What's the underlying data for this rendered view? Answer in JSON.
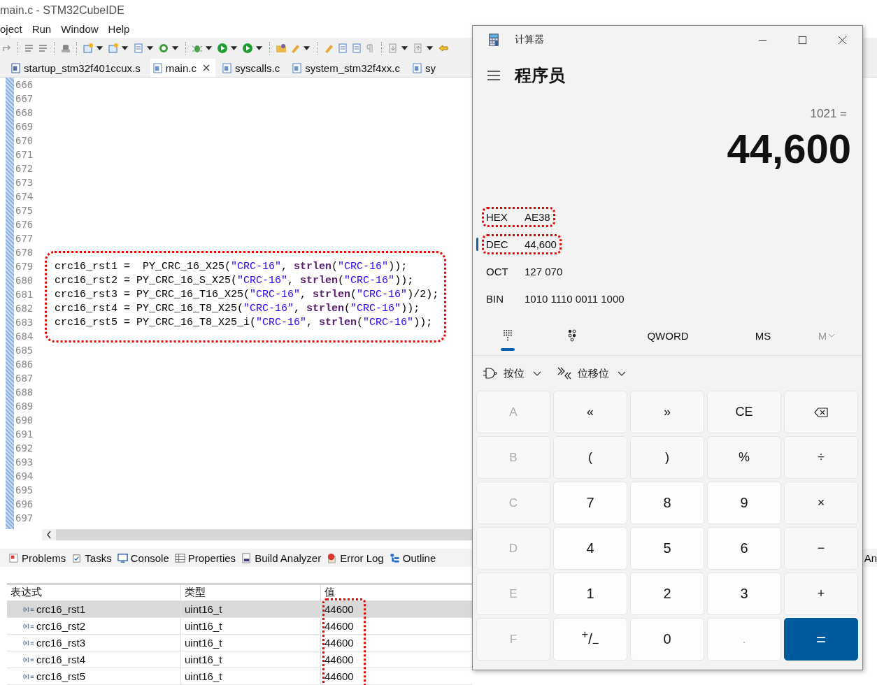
{
  "ide": {
    "title": "main.c - STM32CubeIDE",
    "menu": [
      "oject",
      "Run",
      "Window",
      "Help"
    ],
    "editor_tabs": [
      {
        "label": "startup_stm32f401ccux.s",
        "kind": "asm",
        "selected": false
      },
      {
        "label": "main.c",
        "kind": "c",
        "selected": true
      },
      {
        "label": "syscalls.c",
        "kind": "c",
        "selected": false
      },
      {
        "label": "system_stm32f4xx.c",
        "kind": "c",
        "selected": false
      },
      {
        "label": "sy",
        "kind": "c",
        "selected": false
      }
    ],
    "editor": {
      "outlined": true,
      "lines": [
        {
          "number": "666"
        },
        {
          "number": "667"
        },
        {
          "number": "668"
        },
        {
          "number": "669"
        },
        {
          "number": "670"
        },
        {
          "number": "671"
        },
        {
          "number": "672"
        },
        {
          "number": "673"
        },
        {
          "number": "674"
        },
        {
          "number": "675"
        },
        {
          "number": "676"
        },
        {
          "number": "677"
        },
        {
          "number": "678"
        },
        {
          "number": "679",
          "code": [
            {
              "kind": "plain",
              "text": "crc16_rst1 =  PY_CRC_16_X25("
            },
            {
              "kind": "string",
              "text": "\"CRC-16\""
            },
            {
              "kind": "plain",
              "text": ", "
            },
            {
              "kind": "keyword",
              "text": "strlen"
            },
            {
              "kind": "plain",
              "text": "("
            },
            {
              "kind": "string",
              "text": "\"CRC-16\""
            },
            {
              "kind": "plain",
              "text": "));"
            }
          ]
        },
        {
          "number": "680",
          "code": [
            {
              "kind": "plain",
              "text": "crc16_rst2 = PY_CRC_16_S_X25("
            },
            {
              "kind": "string",
              "text": "\"CRC-16\""
            },
            {
              "kind": "plain",
              "text": ", "
            },
            {
              "kind": "keyword",
              "text": "strlen"
            },
            {
              "kind": "plain",
              "text": "("
            },
            {
              "kind": "string",
              "text": "\"CRC-16\""
            },
            {
              "kind": "plain",
              "text": "));"
            }
          ]
        },
        {
          "number": "681",
          "code": [
            {
              "kind": "plain",
              "text": "crc16_rst3 = PY_CRC_16_T16_X25("
            },
            {
              "kind": "string",
              "text": "\"CRC-16\""
            },
            {
              "kind": "plain",
              "text": ", "
            },
            {
              "kind": "keyword",
              "text": "strlen"
            },
            {
              "kind": "plain",
              "text": "("
            },
            {
              "kind": "string",
              "text": "\"CRC-16\""
            },
            {
              "kind": "plain",
              "text": ")/2);"
            }
          ]
        },
        {
          "number": "682",
          "code": [
            {
              "kind": "plain",
              "text": "crc16_rst4 = PY_CRC_16_T8_X25("
            },
            {
              "kind": "string",
              "text": "\"CRC-16\""
            },
            {
              "kind": "plain",
              "text": ", "
            },
            {
              "kind": "keyword",
              "text": "strlen"
            },
            {
              "kind": "plain",
              "text": "("
            },
            {
              "kind": "string",
              "text": "\"CRC-16\""
            },
            {
              "kind": "plain",
              "text": "));"
            }
          ]
        },
        {
          "number": "683",
          "code": [
            {
              "kind": "plain",
              "text": "crc16_rst5 = PY_CRC_16_T8_X25_i("
            },
            {
              "kind": "string",
              "text": "\"CRC-16\""
            },
            {
              "kind": "plain",
              "text": ", "
            },
            {
              "kind": "keyword",
              "text": "strlen"
            },
            {
              "kind": "plain",
              "text": "("
            },
            {
              "kind": "string",
              "text": "\"CRC-16\""
            },
            {
              "kind": "plain",
              "text": "));"
            }
          ]
        },
        {
          "number": "684"
        },
        {
          "number": "685"
        },
        {
          "number": "686"
        },
        {
          "number": "687"
        },
        {
          "number": "688"
        },
        {
          "number": "689"
        },
        {
          "number": "690"
        },
        {
          "number": "691"
        },
        {
          "number": "692"
        },
        {
          "number": "693"
        },
        {
          "number": "694"
        },
        {
          "number": "695"
        },
        {
          "number": "696"
        },
        {
          "number": "697"
        }
      ]
    },
    "panel_tabs": [
      "Problems",
      "Tasks",
      "Console",
      "Properties",
      "Build Analyzer",
      "Error Log",
      "Outline",
      "An"
    ],
    "watch_table": {
      "value_column_outlined": true,
      "columns": [
        {
          "label": "表达式"
        },
        {
          "label": "类型"
        },
        {
          "label": "值"
        }
      ],
      "rows": [
        {
          "selected": true,
          "cells": [
            "crc16_rst1",
            "uint16_t",
            "44600"
          ]
        },
        {
          "selected": false,
          "cells": [
            "crc16_rst2",
            "uint16_t",
            "44600"
          ]
        },
        {
          "selected": false,
          "cells": [
            "crc16_rst3",
            "uint16_t",
            "44600"
          ]
        },
        {
          "selected": false,
          "cells": [
            "crc16_rst4",
            "uint16_t",
            "44600"
          ]
        },
        {
          "selected": false,
          "cells": [
            "crc16_rst5",
            "uint16_t",
            "44600"
          ]
        }
      ]
    }
  },
  "calculator": {
    "title": "计算器",
    "mode": "程序员",
    "expression": "1021 =",
    "result": "44,600",
    "radix": [
      {
        "label": "HEX",
        "value": "AE38",
        "selected": false,
        "outlined": true
      },
      {
        "label": "DEC",
        "value": "44,600",
        "selected": true,
        "outlined": true
      },
      {
        "label": "OCT",
        "value": "127 070",
        "selected": false,
        "outlined": false
      },
      {
        "label": "BIN",
        "value": "1010 1110 0011 1000",
        "selected": false,
        "outlined": false
      }
    ],
    "view_tabs": [
      {
        "kind": "keypad",
        "selected": true,
        "disabled": false
      },
      {
        "kind": "bits",
        "selected": false,
        "disabled": false
      },
      {
        "kind": "text",
        "label": "QWORD",
        "selected": false,
        "disabled": false
      },
      {
        "kind": "text",
        "label": "MS",
        "selected": false,
        "disabled": false
      },
      {
        "kind": "memory-menu",
        "label": "M",
        "selected": false,
        "disabled": true
      }
    ],
    "bit_menus": [
      {
        "kind": "bitwise",
        "label": "按位"
      },
      {
        "kind": "shift",
        "label": "位移位"
      }
    ],
    "keypad": [
      [
        {
          "label": "A",
          "kind": "letter",
          "disabled": true
        },
        {
          "label": "«",
          "kind": "op",
          "disabled": false
        },
        {
          "label": "»",
          "kind": "op",
          "disabled": false
        },
        {
          "label": "CE",
          "kind": "op",
          "disabled": false
        },
        {
          "kind": "backspace",
          "disabled": false
        }
      ],
      [
        {
          "label": "B",
          "kind": "letter",
          "disabled": true
        },
        {
          "label": "(",
          "kind": "op",
          "disabled": false
        },
        {
          "label": ")",
          "kind": "op",
          "disabled": false
        },
        {
          "label": "%",
          "kind": "op",
          "disabled": false
        },
        {
          "label": "÷",
          "kind": "op",
          "disabled": false
        }
      ],
      [
        {
          "label": "C",
          "kind": "letter",
          "disabled": true
        },
        {
          "label": "7",
          "kind": "digit",
          "disabled": false
        },
        {
          "label": "8",
          "kind": "digit",
          "disabled": false
        },
        {
          "label": "9",
          "kind": "digit",
          "disabled": false
        },
        {
          "label": "×",
          "kind": "op",
          "disabled": false
        }
      ],
      [
        {
          "label": "D",
          "kind": "letter",
          "disabled": true
        },
        {
          "label": "4",
          "kind": "digit",
          "disabled": false
        },
        {
          "label": "5",
          "kind": "digit",
          "disabled": false
        },
        {
          "label": "6",
          "kind": "digit",
          "disabled": false
        },
        {
          "label": "−",
          "kind": "op",
          "disabled": false
        }
      ],
      [
        {
          "label": "E",
          "kind": "letter",
          "disabled": true
        },
        {
          "label": "1",
          "kind": "digit",
          "disabled": false
        },
        {
          "label": "2",
          "kind": "digit",
          "disabled": false
        },
        {
          "label": "3",
          "kind": "digit",
          "disabled": false
        },
        {
          "label": "+",
          "kind": "op",
          "disabled": false
        }
      ],
      [
        {
          "label": "F",
          "kind": "letter",
          "disabled": true
        },
        {
          "label": "$^{+}$/$_{−}$",
          "kind": "digit",
          "disabled": false
        },
        {
          "label": "0",
          "kind": "digit",
          "disabled": false
        },
        {
          "label": ".",
          "kind": "digit",
          "disabled": true
        },
        {
          "label": "=",
          "kind": "equals",
          "disabled": false
        }
      ]
    ]
  }
}
